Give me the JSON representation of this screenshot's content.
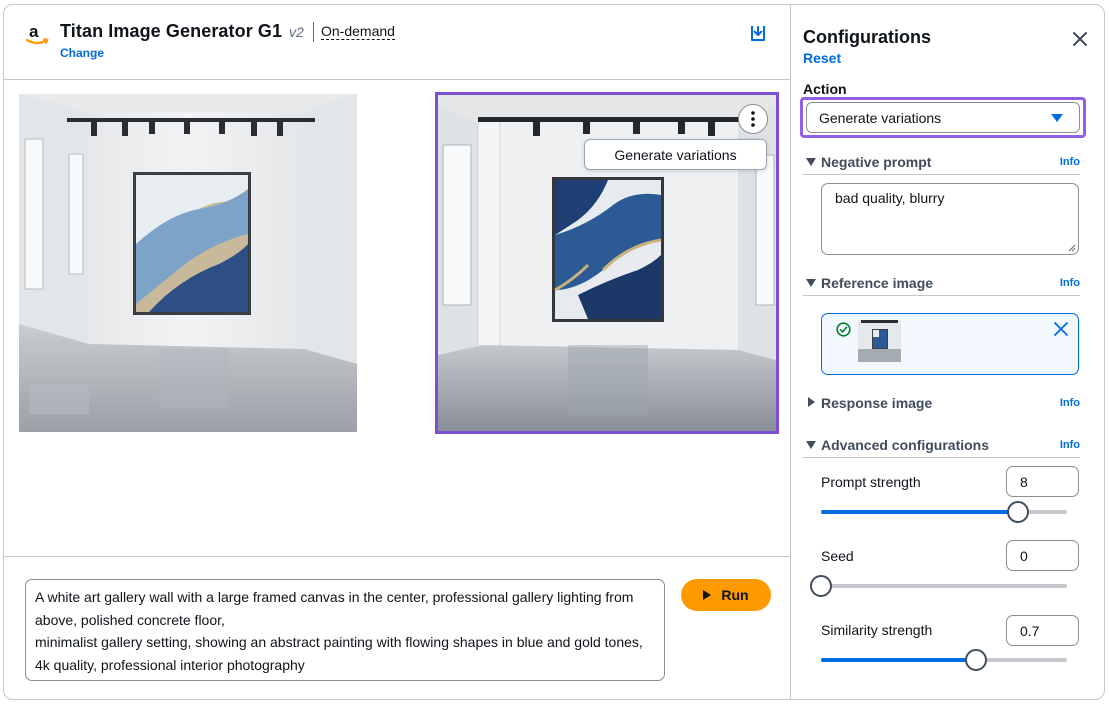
{
  "header": {
    "title": "Titan Image Generator G1",
    "version": "v2",
    "mode": "On-demand",
    "change_link": "Change",
    "brand_color": "#ff9900"
  },
  "gallery": {
    "images": [
      {
        "name": "generated-image-1",
        "selected": false
      },
      {
        "name": "generated-image-2",
        "selected": true
      }
    ],
    "menu_item": "Generate variations",
    "selection_color": "#7d4fd1"
  },
  "prompt": {
    "text": "A white art gallery wall with a large framed canvas in the center, professional gallery lighting from above, polished concrete floor,\nminimalist gallery setting, showing an abstract painting with flowing shapes in blue and gold tones, 4k quality, professional interior photography",
    "run_label": "Run"
  },
  "config": {
    "title": "Configurations",
    "reset": "Reset",
    "action_label": "Action",
    "action_value": "Generate variations",
    "negative": {
      "title": "Negative prompt",
      "info": "Info",
      "value": "bad quality, blurry"
    },
    "reference": {
      "title": "Reference image",
      "info": "Info"
    },
    "response": {
      "title": "Response image",
      "info": "Info"
    },
    "advanced": {
      "title": "Advanced configurations",
      "info": "Info"
    },
    "prompt_strength": {
      "label": "Prompt strength",
      "value": "8",
      "slider_fraction": 0.8
    },
    "seed": {
      "label": "Seed",
      "value": "0",
      "slider_fraction": 0.0
    },
    "similarity": {
      "label": "Similarity strength",
      "value": "0.7",
      "slider_fraction": 0.63
    },
    "accent_color": "#006ce0"
  }
}
